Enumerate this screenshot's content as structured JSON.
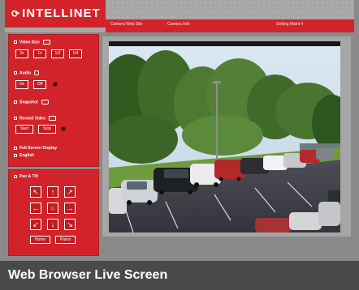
{
  "brand": {
    "logo_text": "INTELLINET",
    "logo_mark": "⟳"
  },
  "nav": {
    "links": [
      "Camera Web Site",
      "Camera Info",
      "Setting Maint #"
    ]
  },
  "controls": {
    "video_size_label": "Video Size",
    "video_size_buttons": [
      "2x",
      "1x",
      "1/2",
      "1/4"
    ],
    "audio_label": "Audio",
    "audio_buttons": [
      "On",
      "Off"
    ],
    "snapshot_label": "Snapshot",
    "record_label": "Record Video",
    "record_buttons": [
      "Start",
      "Stop"
    ],
    "fullscreen_label": "Full Screen Display",
    "english_label": "English"
  },
  "ptz": {
    "label": "Pan & Tilt",
    "arrows": [
      "↖",
      "↑",
      "↗",
      "←",
      "○",
      "→",
      "↙",
      "↓",
      "↘"
    ],
    "buttons": [
      "Home",
      "Patrol"
    ]
  },
  "caption": {
    "text": "Web Browser Live Screen"
  },
  "colors": {
    "brand_red": "#d2232a",
    "panel_gray": "#a6a6a6",
    "caption_bg": "#4a4a4a"
  }
}
